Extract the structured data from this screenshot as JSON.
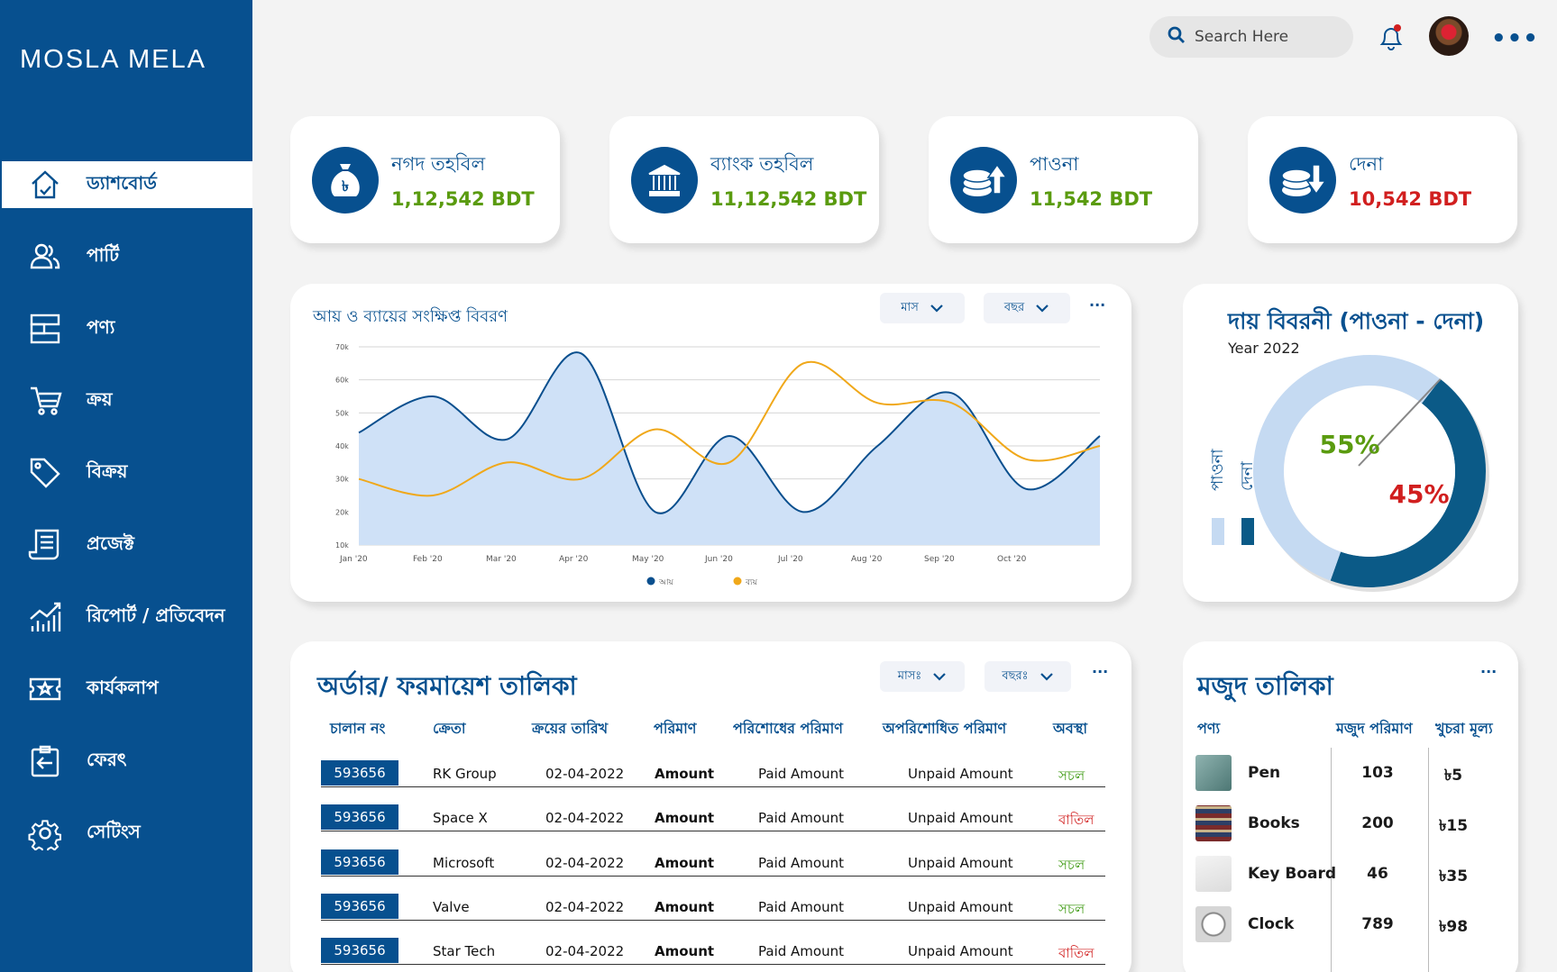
{
  "app": {
    "brand": "MOSLA MELA"
  },
  "sidebar": {
    "items": [
      {
        "label": "ড্যাশবোর্ড",
        "icon": "home-icon",
        "active": true
      },
      {
        "label": "পার্টি",
        "icon": "users-icon"
      },
      {
        "label": "পণ্য",
        "icon": "product-icon"
      },
      {
        "label": "ক্রয়",
        "icon": "cart-icon"
      },
      {
        "label": "বিক্রয়",
        "icon": "tag-icon"
      },
      {
        "label": "প্রজেক্ট",
        "icon": "document-icon"
      },
      {
        "label": "রিপোর্ট / প্রতিবেদন",
        "icon": "chart-icon"
      },
      {
        "label": "কার্যকলাপ",
        "icon": "activity-icon"
      },
      {
        "label": "ফেরৎ",
        "icon": "return-icon"
      },
      {
        "label": "সেটিংস",
        "icon": "gear-icon"
      }
    ]
  },
  "topbar": {
    "search_placeholder": "Search Here",
    "notification_icon": "bell-icon"
  },
  "stats": [
    {
      "title": "নগদ তহবিল",
      "value": "1,12,542 BDT",
      "color": "#5a9b0f",
      "icon": "money-bag-icon"
    },
    {
      "title": "ব্যাংক  তহবিল",
      "value": "11,12,542 BDT",
      "color": "#5a9b0f",
      "icon": "bank-icon"
    },
    {
      "title": "পাওনা",
      "value": "11,542 BDT",
      "color": "#5a9b0f",
      "icon": "coins-up-icon"
    },
    {
      "title": "দেনা",
      "value": "10,542 BDT",
      "color": "#d11f1f",
      "icon": "coins-down-icon"
    }
  ],
  "line_chart": {
    "title": "আয় ও ব্যায়ের সংক্ষিপ্ত বিবরণ",
    "filter_month": "মাস",
    "filter_year": "বছর",
    "more": "···"
  },
  "chart_data": [
    {
      "type": "line",
      "title": "আয় ও ব্যায়ের সংক্ষিপ্ত বিবরণ",
      "x": [
        "Jan '20",
        "Feb '20",
        "Mar '20",
        "Apr '20",
        "May '20",
        "Jun '20",
        "Jul '20",
        "Aug '20",
        "Sep '20",
        "Oct '20"
      ],
      "y_ticks": [
        "10k",
        "20k",
        "30k",
        "40k",
        "50k",
        "60k",
        "70k"
      ],
      "ylim": [
        10000,
        70000
      ],
      "series": [
        {
          "name": "আয়",
          "color": "#0a4f8e",
          "fill": "#cfe1f7",
          "values": [
            44000,
            55000,
            42000,
            68000,
            20000,
            43000,
            20000,
            40000,
            56000,
            27000,
            43000
          ]
        },
        {
          "name": "ব্যয়",
          "color": "#f0a81a",
          "values": [
            30000,
            25000,
            35000,
            30000,
            45000,
            35000,
            65000,
            53000,
            53000,
            36000,
            40000
          ]
        }
      ],
      "legend_position": "bottom"
    },
    {
      "type": "pie",
      "title": "দায় বিবরনী (পাওনা - দেনা)",
      "subtitle": "Year 2022",
      "slices": [
        {
          "name": "পাওনা",
          "value": 55,
          "label": "55%",
          "color": "#c5daf2",
          "label_color": "#5a9b0f"
        },
        {
          "name": "দেনা",
          "value": 45,
          "label": "45%",
          "color": "#0b5a87",
          "label_color": "#d11f1f"
        }
      ]
    }
  ],
  "orders": {
    "title": "অর্ডার/ ফরমায়েশ তালিকা",
    "filter_month": "মাসঃ",
    "filter_year": "বছরঃ",
    "more": "···",
    "columns": [
      "চালান নং",
      "ক্রেতা",
      "ক্রয়ের তারিখ",
      "পরিমাণ",
      "পরিশোধের পরিমাণ",
      "অপরিশোধিত পরিমাণ",
      "অবস্থা"
    ],
    "rows": [
      {
        "invoice": "593656",
        "buyer": "RK Group",
        "date": "02-04-2022",
        "amount": "Amount",
        "paid": "Paid Amount",
        "unpaid": "Unpaid Amount",
        "status": "সচল",
        "status_color": "#3d9a12"
      },
      {
        "invoice": "593656",
        "buyer": "Space X",
        "date": "02-04-2022",
        "amount": "Amount",
        "paid": "Paid Amount",
        "unpaid": "Unpaid Amount",
        "status": "বাতিল",
        "status_color": "#d11f1f"
      },
      {
        "invoice": "593656",
        "buyer": "Microsoft",
        "date": "02-04-2022",
        "amount": "Amount",
        "paid": "Paid Amount",
        "unpaid": "Unpaid Amount",
        "status": "সচল",
        "status_color": "#3d9a12"
      },
      {
        "invoice": "593656",
        "buyer": "Valve",
        "date": "02-04-2022",
        "amount": "Amount",
        "paid": "Paid Amount",
        "unpaid": "Unpaid Amount",
        "status": "সচল",
        "status_color": "#3d9a12"
      },
      {
        "invoice": "593656",
        "buyer": "Star Tech",
        "date": "02-04-2022",
        "amount": "Amount",
        "paid": "Paid Amount",
        "unpaid": "Unpaid Amount",
        "status": "বাতিল",
        "status_color": "#d11f1f"
      }
    ]
  },
  "stock": {
    "title": "মজুদ তালিকা",
    "more": "···",
    "columns": [
      "পণ্য",
      "মজুদ পরিমাণ",
      "খুচরা মূল্য"
    ],
    "rows": [
      {
        "name": "Pen",
        "qty": "103",
        "price": "৳5",
        "thumb": "#5f8a88"
      },
      {
        "name": "Books",
        "qty": "200",
        "price": "৳15",
        "thumb": "#7a2b2b"
      },
      {
        "name": "Key Board",
        "qty": "46",
        "price": "৳35",
        "thumb": "#e6e6e6"
      },
      {
        "name": "Clock",
        "qty": "789",
        "price": "৳98",
        "thumb": "#d9d9d9"
      }
    ]
  }
}
